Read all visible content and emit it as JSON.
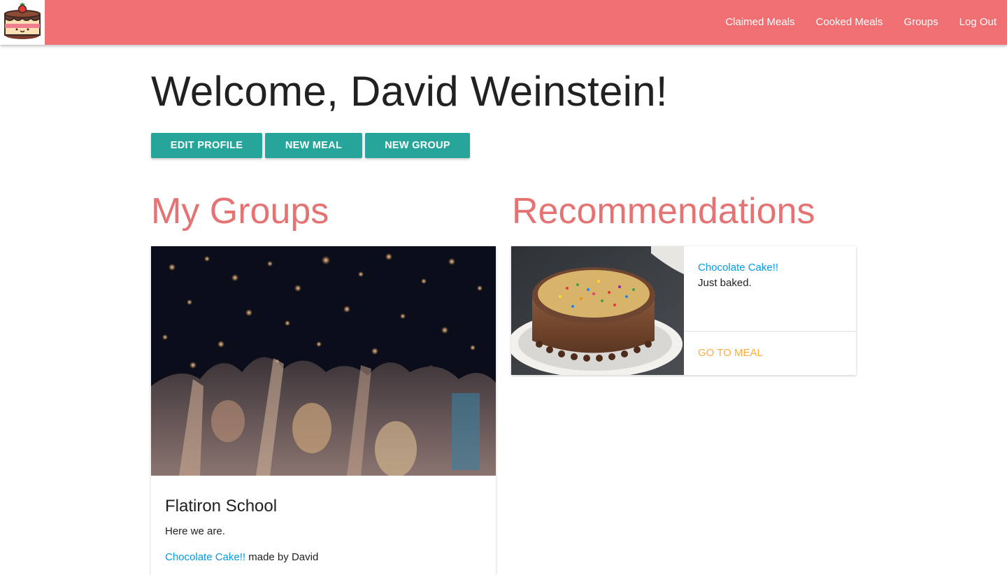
{
  "nav": {
    "logo_icon": "cake-logo-icon",
    "links": [
      "Claimed Meals",
      "Cooked Meals",
      "Groups",
      "Log Out"
    ],
    "background": "#ef6f72"
  },
  "main": {
    "welcome": "Welcome, David Weinstein!",
    "buttons": {
      "edit_profile": "EDIT PROFILE",
      "new_meal": "NEW MEAL",
      "new_group": "NEW GROUP"
    },
    "button_color": "#26a69a",
    "my_groups_title": "My Groups",
    "recommendations_title": "Recommendations",
    "accent_color": "#e57373"
  },
  "groups": [
    {
      "name": "Flatiron School",
      "description": "Here we are.",
      "meal_link": "Chocolate Cake!!",
      "meal_suffix": " made by David"
    }
  ],
  "recommendations": [
    {
      "title": "Chocolate Cake!!",
      "description": "Just baked.",
      "action": "GO TO MEAL"
    }
  ]
}
